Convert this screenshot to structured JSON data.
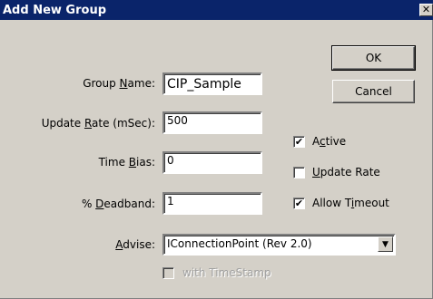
{
  "window": {
    "title": "Add New Group",
    "close_glyph": "✕"
  },
  "buttons": {
    "ok": "OK",
    "cancel": "Cancel"
  },
  "fields": {
    "group_name": {
      "pre": "Group ",
      "key": "N",
      "post": "ame:",
      "value": "CIP_Sample"
    },
    "update_rate": {
      "pre": "Update ",
      "key": "R",
      "post": "ate (mSec):",
      "value": "500"
    },
    "time_bias": {
      "pre": "Time ",
      "key": "B",
      "post": "ias:",
      "value": "0"
    },
    "deadband": {
      "pre": "% ",
      "key": "D",
      "post": "eadband:",
      "value": "1"
    },
    "advise": {
      "pre": "",
      "key": "A",
      "post": "dvise:",
      "value": "IConnectionPoint (Rev 2.0)"
    }
  },
  "checkboxes": {
    "active": {
      "pre": "A",
      "key": "c",
      "post": "tive",
      "checked": true,
      "mark": "✔"
    },
    "update_rate": {
      "pre": "",
      "key": "U",
      "post": "pdate Rate",
      "checked": false,
      "mark": ""
    },
    "allow_timeout": {
      "pre": "Allow T",
      "key": "i",
      "post": "meout",
      "checked": true,
      "mark": "✔"
    },
    "with_timestamp": {
      "label": "with TimeStamp",
      "checked": false,
      "enabled": false,
      "mark": ""
    }
  },
  "icons": {
    "dropdown_arrow": "▼"
  }
}
